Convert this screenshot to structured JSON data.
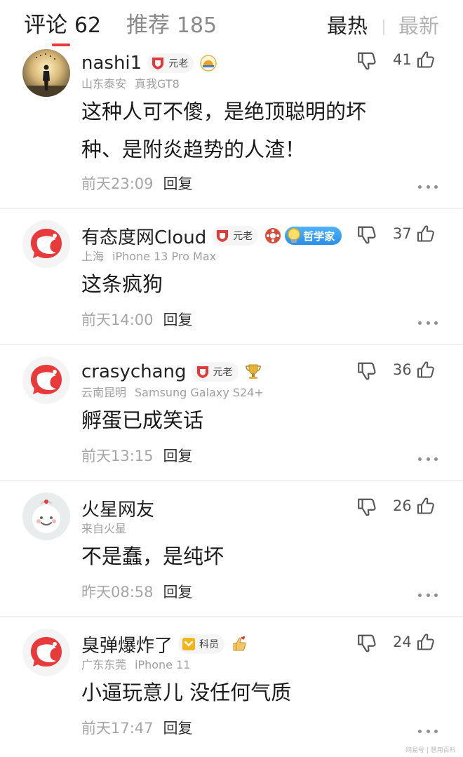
{
  "tabs": {
    "comments_label": "评论",
    "comments_count": "62",
    "recommend_label": "推荐",
    "recommend_count": "185",
    "sort_hot": "最热",
    "sort_new": "最新"
  },
  "colors": {
    "accent": "#e8393b",
    "badge_red": "#e5383b",
    "badge_gold": "#f2b51c",
    "tag_blue": "#2a8ee8"
  },
  "comments": [
    {
      "username": "nashi1",
      "badge": "元老",
      "badge_icon": "red-shield-icon",
      "medals": [
        "sunrise-medal-icon"
      ],
      "location": "山东泰安",
      "device": "真我GT8",
      "content_line1": "这种人可不傻，是绝顶聪明的坏",
      "content_line2": "种、是附炎趋势的人渣！",
      "time": "前天23:09",
      "reply": "回复",
      "likes": "41",
      "avatar": "sunset-silhouette-avatar"
    },
    {
      "username": "有态度网Cloud",
      "badge": "元老",
      "badge_icon": "red-shield-icon",
      "medals": [
        "film-reel-medal-icon"
      ],
      "title_tag": "哲学家",
      "location": "上海",
      "device": "iPhone 13 Pro Max",
      "content": "这条疯狗",
      "time": "前天14:00",
      "reply": "回复",
      "likes": "37",
      "avatar": "netease-red-bubble-avatar"
    },
    {
      "username": "crasychang",
      "badge": "元老",
      "badge_icon": "red-shield-icon",
      "medals": [
        "trophy-medal-icon"
      ],
      "location": "云南昆明",
      "device": "Samsung Galaxy S24+",
      "content": "孵蛋已成笑话",
      "time": "前天13:15",
      "reply": "回复",
      "likes": "36",
      "avatar": "netease-red-bubble-avatar"
    },
    {
      "username": "火星网友",
      "location": "来自火星",
      "content": "不是蠢，是纯坏",
      "time": "昨天08:58",
      "reply": "回复",
      "likes": "26",
      "avatar": "alien-smile-avatar"
    },
    {
      "username": "臭弹爆炸了",
      "badge": "科员",
      "badge_icon": "gold-chevron-icon",
      "medals": [
        "thumbs-heart-medal-icon"
      ],
      "location": "广东东莞",
      "device": "iPhone 11",
      "content": "小逼玩意儿 没任何气质",
      "time": "前天17:47",
      "reply": "回复",
      "likes": "24",
      "avatar": "netease-red-bubble-avatar"
    }
  ],
  "watermark": "网易号 | 慧用百科"
}
